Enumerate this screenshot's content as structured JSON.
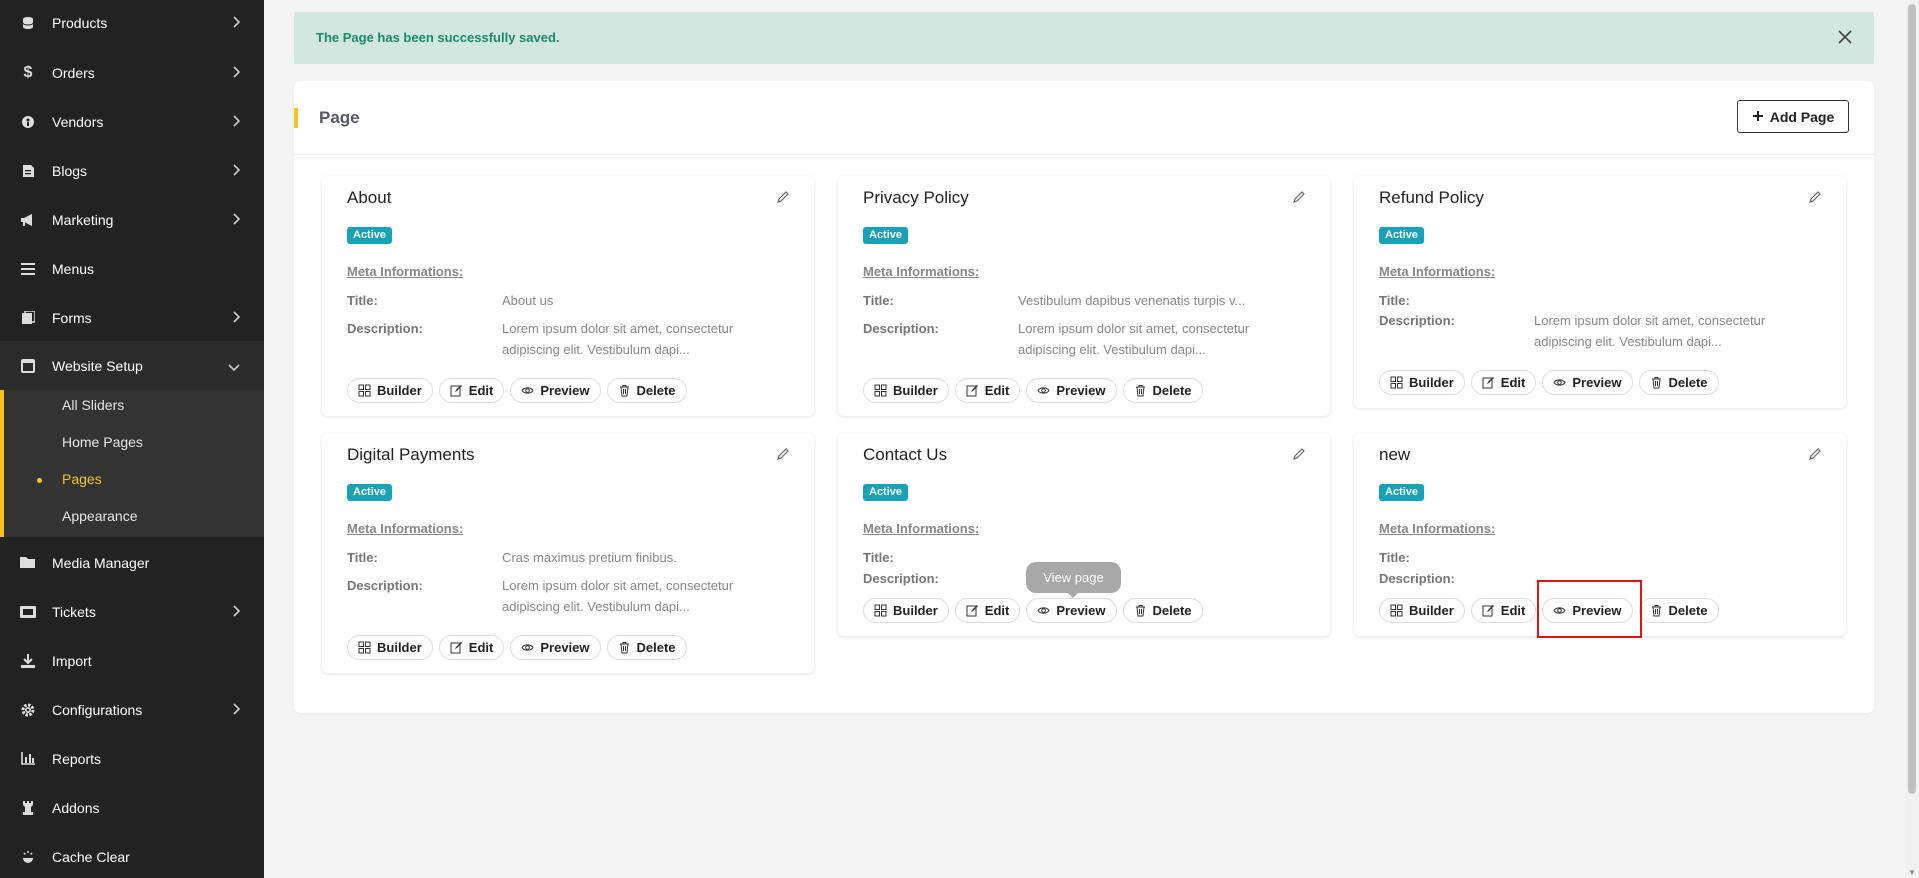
{
  "sidebar": {
    "items": [
      {
        "label": "Products",
        "icon": "database-icon",
        "chevron": true
      },
      {
        "label": "Orders",
        "icon": "dollar-icon",
        "chevron": true
      },
      {
        "label": "Vendors",
        "icon": "vendor-icon",
        "chevron": true
      },
      {
        "label": "Blogs",
        "icon": "blog-icon",
        "chevron": true
      },
      {
        "label": "Marketing",
        "icon": "megaphone-icon",
        "chevron": true
      },
      {
        "label": "Menus",
        "icon": "menu-icon",
        "chevron": false
      },
      {
        "label": "Forms",
        "icon": "forms-icon",
        "chevron": true
      },
      {
        "label": "Website Setup",
        "icon": "website-icon",
        "chevron": true
      },
      {
        "label": "Media Manager",
        "icon": "folder-icon",
        "chevron": false
      },
      {
        "label": "Tickets",
        "icon": "ticket-icon",
        "chevron": true
      },
      {
        "label": "Import",
        "icon": "import-icon",
        "chevron": false
      },
      {
        "label": "Configurations",
        "icon": "gear-icon",
        "chevron": true
      },
      {
        "label": "Reports",
        "icon": "chart-icon",
        "chevron": false
      },
      {
        "label": "Addons",
        "icon": "chess-rook-icon",
        "chevron": false
      },
      {
        "label": "Cache Clear",
        "icon": "cache-icon",
        "chevron": false
      }
    ],
    "setup_sub": [
      "All Sliders",
      "Home Pages",
      "Pages",
      "Appearance"
    ]
  },
  "alert": {
    "message": "The Page has been successfully saved."
  },
  "panel": {
    "title": "Page",
    "add_label": "Add Page"
  },
  "labels": {
    "meta": "Meta Informations:",
    "title": "Title:",
    "description": "Description:",
    "builder": "Builder",
    "edit": "Edit",
    "preview": "Preview",
    "delete": "Delete"
  },
  "cards": [
    {
      "name": "About",
      "status": "Active",
      "title": "About us",
      "description": "Lorem ipsum dolor sit amet, consectetur adipiscing elit. Vestibulum dapi..."
    },
    {
      "name": "Privacy Policy",
      "status": "Active",
      "title": "Vestibulum dapibus venenatis turpis v...",
      "description": "Lorem ipsum dolor sit amet, consectetur adipiscing elit. Vestibulum dapi..."
    },
    {
      "name": "Refund Policy",
      "status": "Active",
      "title": "",
      "description": "Lorem ipsum dolor sit amet, consectetur adipiscing elit. Vestibulum dapi..."
    },
    {
      "name": "Digital Payments",
      "status": "Active",
      "title": "Cras maximus pretium finibus.",
      "description": "Lorem ipsum dolor sit amet, consectetur adipiscing elit. Vestibulum dapi..."
    },
    {
      "name": "Contact Us",
      "status": "Active",
      "title": "",
      "description": ""
    },
    {
      "name": "new",
      "status": "Active",
      "title": "",
      "description": ""
    }
  ],
  "tooltip": "View page",
  "colors": {
    "sidebar_bg": "#222222",
    "accent": "#f5c518",
    "badge": "#17a2b8",
    "alert_bg": "#d1e7df",
    "alert_text": "#1b8a6b",
    "highlight": "#e01414"
  }
}
